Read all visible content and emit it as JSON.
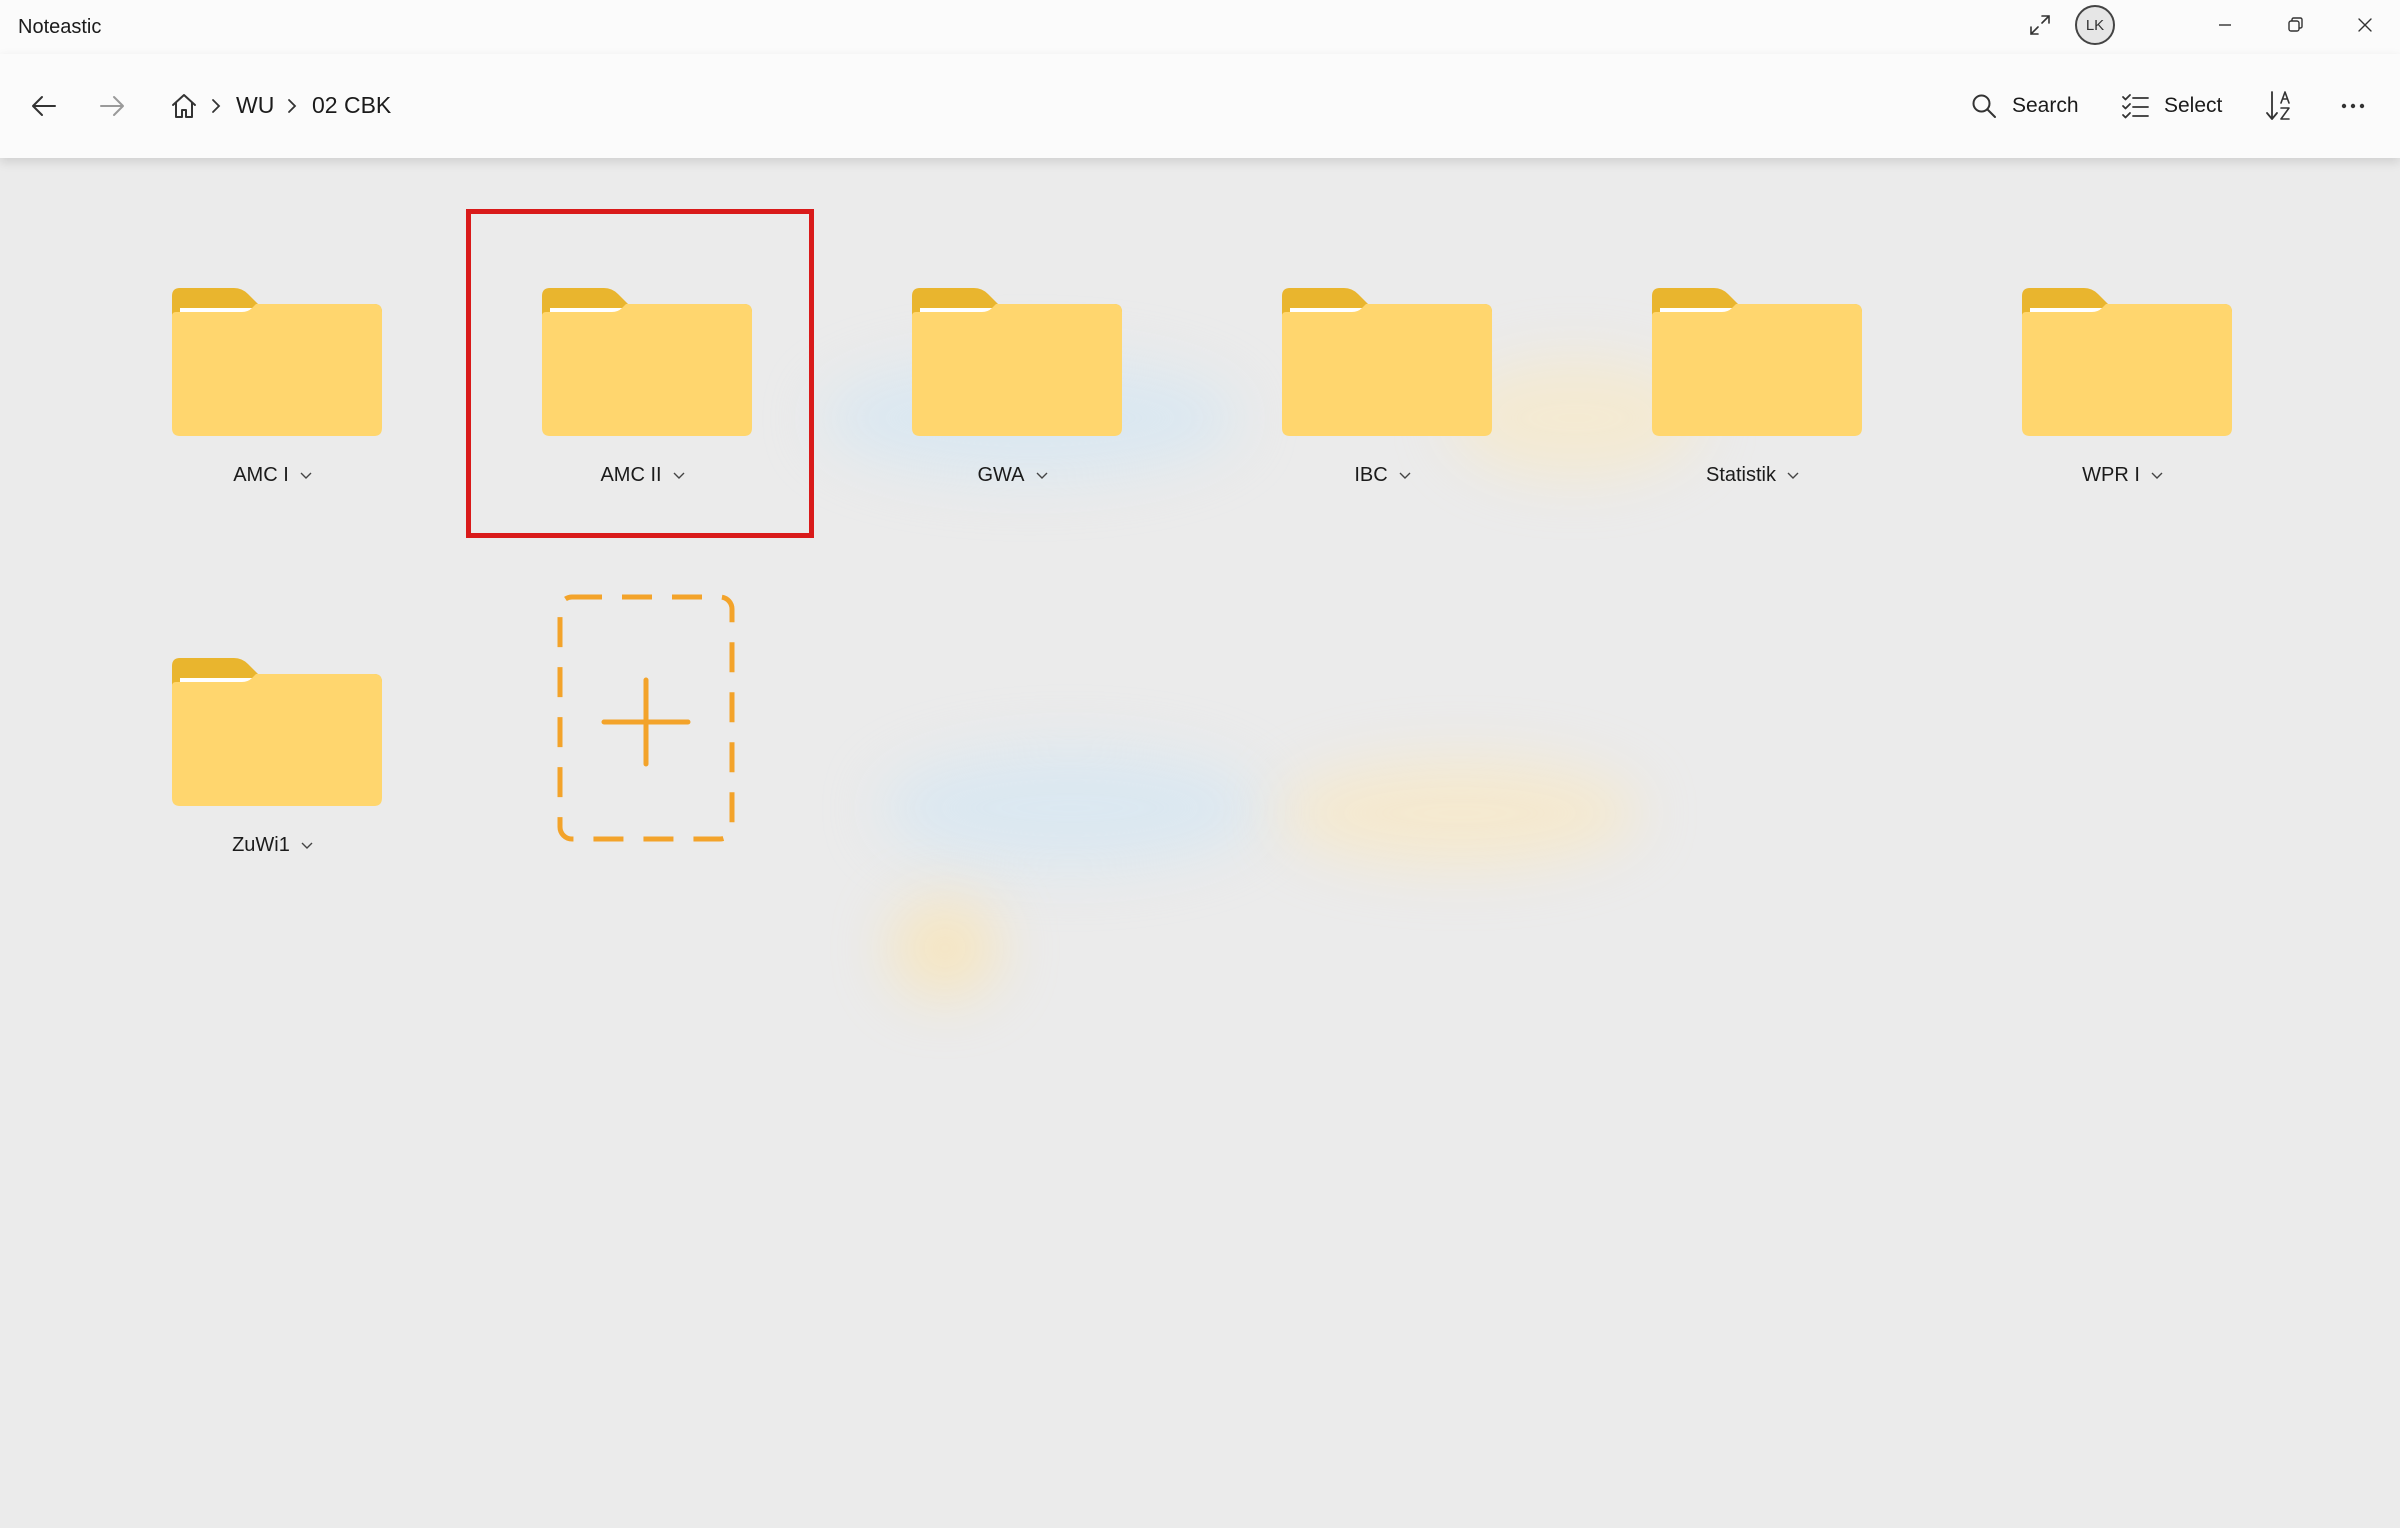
{
  "window": {
    "app_title": "Noteastic",
    "avatar_initials": "LK"
  },
  "breadcrumb": {
    "items": [
      "WU",
      "02 CBK"
    ]
  },
  "commands": {
    "search_label": "Search",
    "select_label": "Select"
  },
  "folders": [
    {
      "name": "AMC I",
      "selected": false
    },
    {
      "name": "AMC II",
      "selected": true
    },
    {
      "name": "GWA",
      "selected": false
    },
    {
      "name": "IBC",
      "selected": false
    },
    {
      "name": "Statistik",
      "selected": false
    },
    {
      "name": "WPR I",
      "selected": false
    },
    {
      "name": "ZuWi1",
      "selected": false
    }
  ],
  "colors": {
    "folder_back": "#e9b52e",
    "folder_front": "#ffd66e",
    "highlight": "#d91a1a",
    "add_accent": "#f3a32a"
  },
  "icons": {
    "back": "arrow-left-icon",
    "forward": "arrow-right-icon",
    "home": "home-icon",
    "search": "search-icon",
    "select": "checklist-icon",
    "sort": "sort-az-icon",
    "more": "more-horizontal-icon",
    "expand": "expand-icon",
    "add": "plus-icon"
  }
}
